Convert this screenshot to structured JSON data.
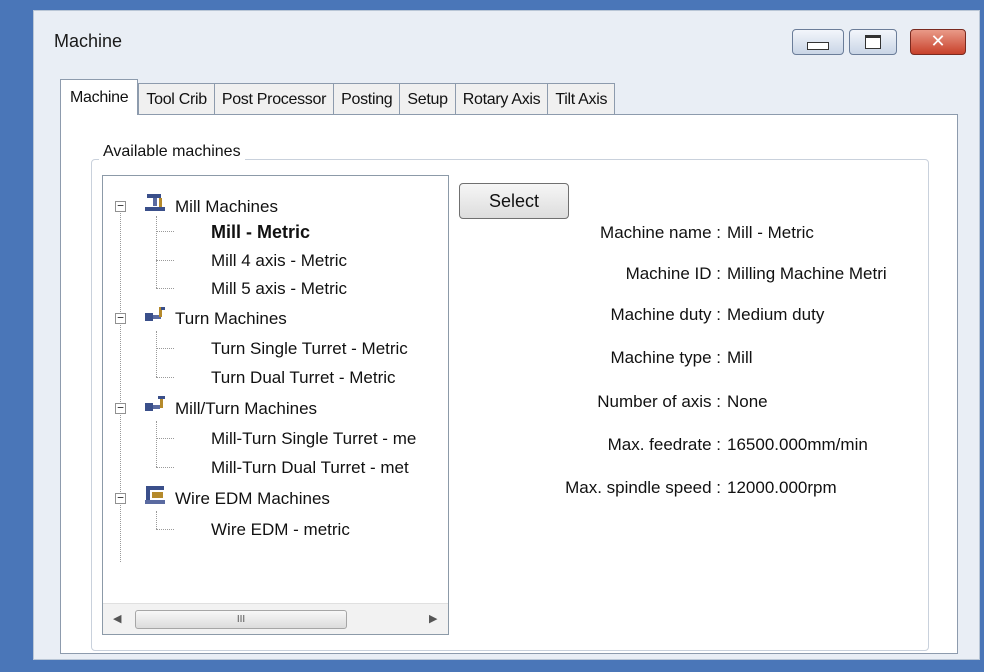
{
  "window": {
    "title": "Machine",
    "buttons": {
      "minimize": "minimize-icon",
      "maximize": "maximize-icon",
      "close": "close-icon"
    }
  },
  "tabs": [
    {
      "label": "Machine",
      "active": true
    },
    {
      "label": "Tool Crib"
    },
    {
      "label": "Post Processor"
    },
    {
      "label": "Posting"
    },
    {
      "label": "Setup"
    },
    {
      "label": "Rotary Axis"
    },
    {
      "label": "Tilt Axis"
    }
  ],
  "group": {
    "label": "Available machines"
  },
  "tree": {
    "categories": [
      {
        "label": "Mill Machines",
        "icon": "mill-machine-icon",
        "items": [
          "Mill - Metric",
          "Mill 4 axis - Metric",
          "Mill 5 axis - Metric"
        ]
      },
      {
        "label": "Turn Machines",
        "icon": "turn-machine-icon",
        "items": [
          "Turn Single Turret - Metric",
          "Turn Dual Turret - Metric"
        ]
      },
      {
        "label": "Mill/Turn Machines",
        "icon": "mill-turn-machine-icon",
        "items": [
          "Mill-Turn Single Turret - me",
          "Mill-Turn Dual Turret - met"
        ]
      },
      {
        "label": "Wire EDM Machines",
        "icon": "wire-edm-machine-icon",
        "items": [
          "Wire EDM - metric"
        ]
      }
    ],
    "selected": "Mill - Metric",
    "scroll_thumb_glyph": "III"
  },
  "select_button": "Select",
  "properties": [
    {
      "label": "Machine name :",
      "value": "Mill - Metric"
    },
    {
      "label": "Machine ID :",
      "value": "Milling Machine Metri"
    },
    {
      "label": "Machine duty :",
      "value": "Medium duty"
    },
    {
      "label": "Machine type :",
      "value": "Mill"
    },
    {
      "label": "Number of axis :",
      "value": "None"
    },
    {
      "label": "Max. feedrate :",
      "value": "16500.000mm/min"
    },
    {
      "label": "Max. spindle speed :",
      "value": "12000.000rpm"
    }
  ]
}
